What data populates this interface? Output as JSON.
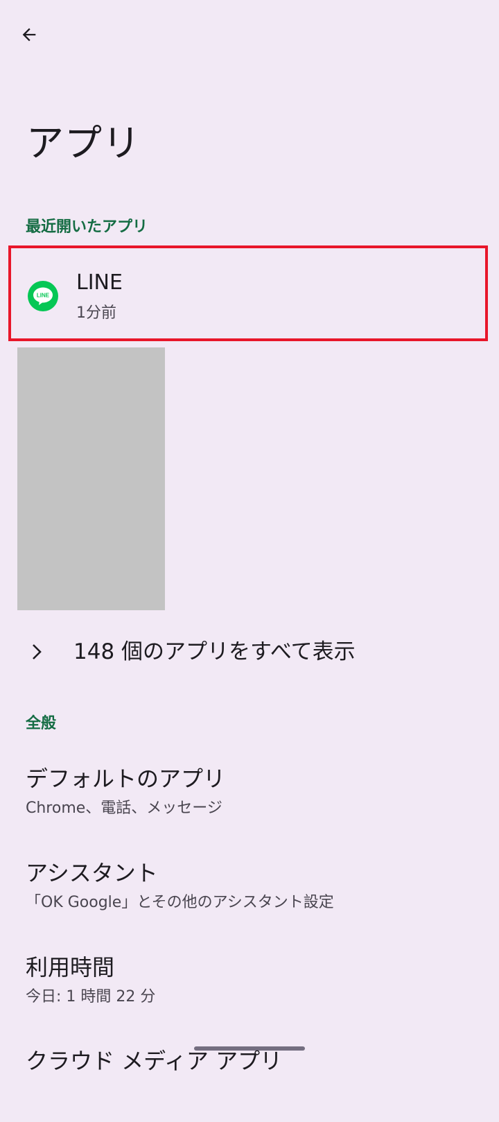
{
  "header": {
    "back_icon": "arrow-left-icon",
    "title": "アプリ"
  },
  "recent": {
    "section_label": "最近開いたアプリ",
    "apps": [
      {
        "name": "LINE",
        "last_used": "1分前",
        "icon": "line-app-icon",
        "icon_label": "LINE",
        "icon_color": "#06C755"
      }
    ]
  },
  "see_all": {
    "label": "148 個のアプリをすべて表示",
    "icon": "chevron-right-icon"
  },
  "general": {
    "section_label": "全般",
    "items": [
      {
        "title": "デフォルトのアプリ",
        "subtitle": "Chrome、電話、メッセージ"
      },
      {
        "title": "アシスタント",
        "subtitle": "「OK Google」とその他のアシスタント設定"
      },
      {
        "title": "利用時間",
        "subtitle": "今日: 1 時間 22 分"
      },
      {
        "title": "クラウド メディア アプリ",
        "subtitle": ""
      }
    ]
  },
  "colors": {
    "background": "#F2E9F5",
    "section_header": "#146C43",
    "highlight_border": "#E8162A"
  }
}
